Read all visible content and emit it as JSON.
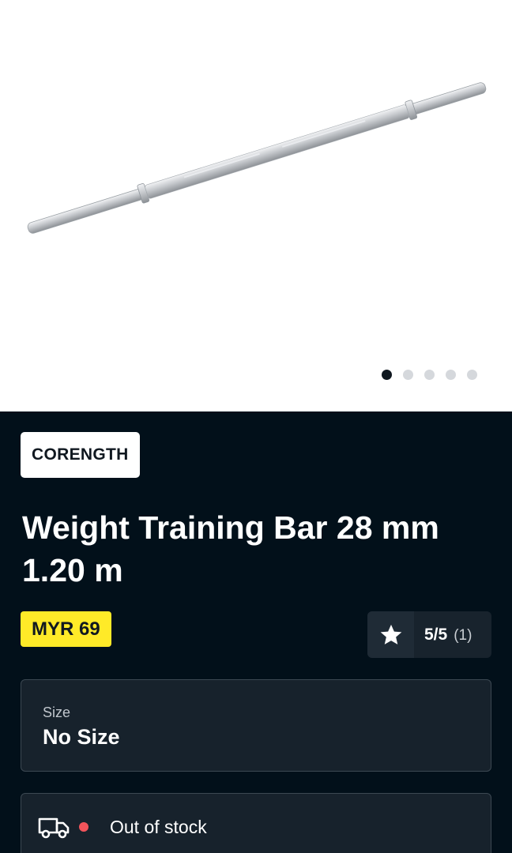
{
  "gallery": {
    "image_alt": "Weight training bar",
    "slide_count": 5,
    "active_slide": 1
  },
  "product": {
    "brand": "CORENGTH",
    "title": "Weight Training Bar 28 mm 1.20 m",
    "price": "MYR 69",
    "rating": {
      "score": "5/5",
      "count": "(1)"
    },
    "size": {
      "label": "Size",
      "value": "No Size"
    },
    "stock": {
      "status": "Out of stock",
      "status_color": "#f2545b"
    }
  },
  "colors": {
    "panel_bg": "#02101a",
    "price_bg": "#ffea28",
    "dot_active": "#101820",
    "dot_inactive": "#d5d8dc"
  },
  "icons": {
    "rating": "star-icon",
    "delivery": "truck-icon"
  }
}
